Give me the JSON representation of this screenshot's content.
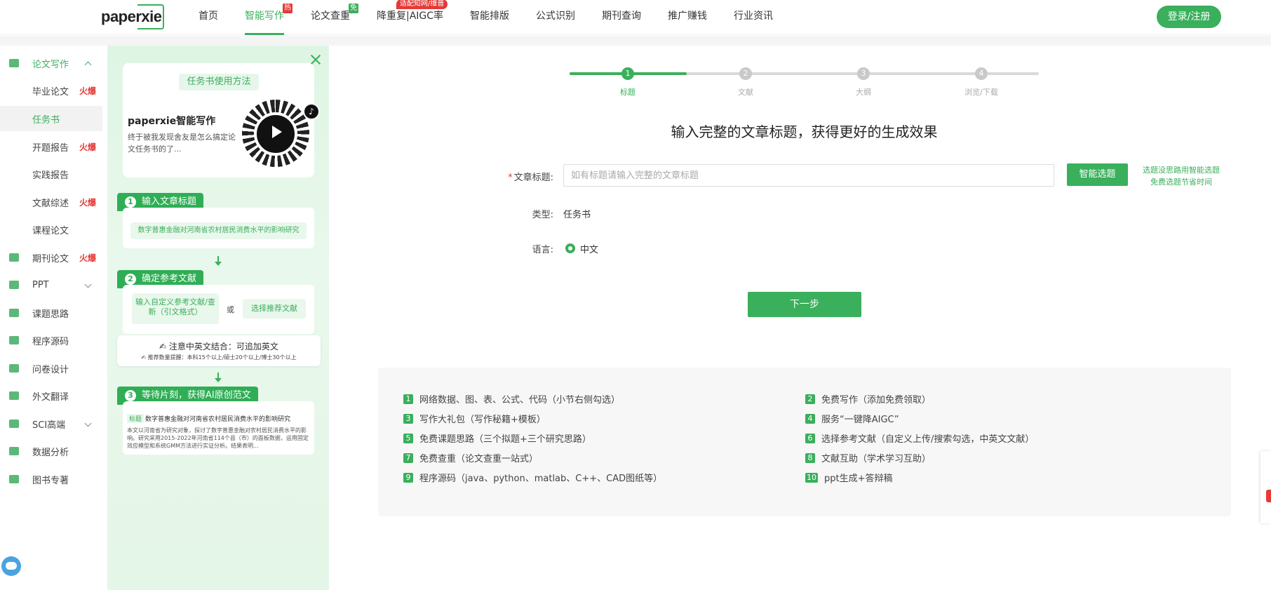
{
  "brand": {
    "logo": "paperxie"
  },
  "nav": {
    "items": [
      {
        "label": "首页",
        "badge": ""
      },
      {
        "label": "智能写作",
        "badge": "热"
      },
      {
        "label": "论文查重",
        "badge": "免"
      },
      {
        "label": "降重复|AIGC率",
        "badge": "适配知网/维普"
      },
      {
        "label": "智能排版",
        "badge": ""
      },
      {
        "label": "公式识别",
        "badge": ""
      },
      {
        "label": "期刊查询",
        "badge": ""
      },
      {
        "label": "推广赚钱",
        "badge": ""
      },
      {
        "label": "行业资讯",
        "badge": ""
      }
    ],
    "active": "智能写作",
    "login": "登录/注册"
  },
  "sidebar": {
    "items": [
      {
        "label": "论文写作",
        "hot": "",
        "expanded": true
      },
      {
        "label": "毕业论文",
        "hot": "火爆"
      },
      {
        "label": "任务书",
        "hot": "",
        "selected": true
      },
      {
        "label": "开题报告",
        "hot": "火爆"
      },
      {
        "label": "实践报告",
        "hot": ""
      },
      {
        "label": "文献综述",
        "hot": "火爆"
      },
      {
        "label": "课程论文",
        "hot": ""
      },
      {
        "label": "期刊论文",
        "hot": "火爆"
      },
      {
        "label": "PPT",
        "hot": ""
      },
      {
        "label": "课题思路",
        "hot": ""
      },
      {
        "label": "程序源码",
        "hot": ""
      },
      {
        "label": "问卷设计",
        "hot": ""
      },
      {
        "label": "外文翻译",
        "hot": ""
      },
      {
        "label": "SCI高端",
        "hot": ""
      },
      {
        "label": "数据分析",
        "hot": ""
      },
      {
        "label": "图书专著",
        "hot": ""
      }
    ]
  },
  "guide": {
    "video_tag": "任务书使用方法",
    "video_title": "paperxie智能写作",
    "video_desc": "终于被我发现舍友是怎么搞定论文任务书的了...",
    "step1": {
      "num": "1",
      "label": "输入文章标题",
      "example": "数字普惠金融对河南省农村居民消费水平的影响研究"
    },
    "step2": {
      "num": "2",
      "label": "确定参考文献",
      "option_a": "输入自定义参考文献/查新（引文格式）",
      "or": "或",
      "option_b": "选择推荐文献"
    },
    "note": {
      "title": "注意中英文结合：可追加英文",
      "sub": "推荐数量提醒：本科15个以上/硕士20个以上/博士30个以上"
    },
    "step3": {
      "num": "3",
      "label": "等待片刻，获得AI原创范文",
      "tag": "标题",
      "title": "数字普惠金融对河南省农村居民消费水平的影响研究",
      "body": "本文以河南省为研究对象，探讨了数字普惠金融对农村居民消费水平的影响。研究采用2015-2022年河南省114个县（市）的面板数据，运用固定效应模型和系统GMM方法进行实证分析。结果表明..."
    }
  },
  "steps": {
    "items": [
      {
        "num": "1",
        "label": "标题"
      },
      {
        "num": "2",
        "label": "文献"
      },
      {
        "num": "3",
        "label": "大纲"
      },
      {
        "num": "4",
        "label": "浏览/下载"
      }
    ],
    "current": 1,
    "progress": 0.25
  },
  "form": {
    "heading": "输入完整的文章标题，获得更好的生成效果",
    "required_mark": "*",
    "title_label": "文章标题:",
    "title_placeholder": "如有标题请输入完整的文章标题",
    "title_value": "",
    "smart_button": "智能选题",
    "hint_line1": "选题没思路用智能选题",
    "hint_line2": "免费选题节省时间",
    "type_label": "类型:",
    "type_value": "任务书",
    "lang_label": "语言:",
    "lang_value": "中文",
    "next_button": "下一步"
  },
  "features": [
    {
      "num": "1",
      "text": "网络数据、图、表、公式、代码（小节右侧勾选）"
    },
    {
      "num": "2",
      "text": "免费写作（添加免费领取）"
    },
    {
      "num": "3",
      "text": "写作大礼包（写作秘籍+模板）"
    },
    {
      "num": "4",
      "text": "服务“一键降AIGC”"
    },
    {
      "num": "5",
      "text": "免费课题思路（三个拟题+三个研究思路）"
    },
    {
      "num": "6",
      "text": "选择参考文献（自定义上传/搜索勾选，中英文文献）"
    },
    {
      "num": "7",
      "text": "免费查重（论文查重一站式）"
    },
    {
      "num": "8",
      "text": "文献互助（学术学习互助）"
    },
    {
      "num": "9",
      "text": "程序源码（java、python、matlab、C++、CAD图纸等）"
    },
    {
      "num": "10",
      "text": "ppt生成+答辩稿"
    }
  ],
  "colors": {
    "brand_green": "#3aaf5c",
    "hot_red": "#e53935",
    "guide_bg": "#e4f6e8"
  }
}
